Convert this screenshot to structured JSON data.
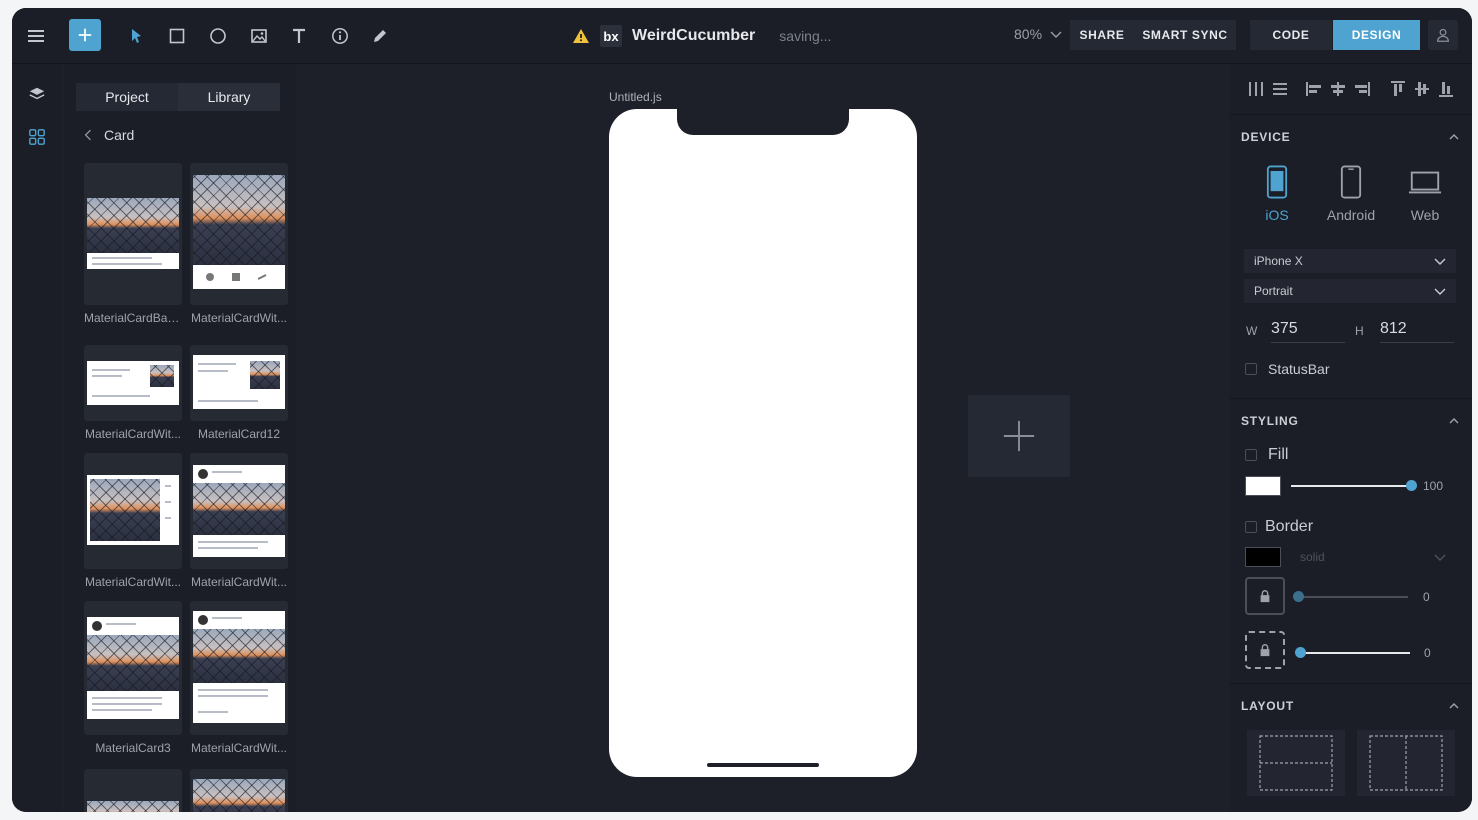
{
  "app": {
    "project_name": "WeirdCucumber",
    "logo_text": "bx",
    "status": "saving...",
    "zoom": "80%"
  },
  "toolbar": {
    "share": "SHARE",
    "smart_sync": "SMART SYNC",
    "code": "CODE",
    "design": "DESIGN"
  },
  "leftpanel": {
    "tabs": [
      {
        "label": "Project"
      },
      {
        "label": "Library"
      }
    ],
    "breadcrumb": "Card",
    "cards": [
      {
        "label": "MaterialCardBasic"
      },
      {
        "label": "MaterialCardWit..."
      },
      {
        "label": "MaterialCardWit..."
      },
      {
        "label": "MaterialCard12"
      },
      {
        "label": "MaterialCardWit..."
      },
      {
        "label": "MaterialCardWit..."
      },
      {
        "label": "MaterialCard3"
      },
      {
        "label": "MaterialCardWit..."
      }
    ]
  },
  "canvas": {
    "file_name": "Untitled.js"
  },
  "rightpanel": {
    "device": {
      "title": "DEVICE",
      "options": [
        {
          "label": "iOS"
        },
        {
          "label": "Android"
        },
        {
          "label": "Web"
        }
      ],
      "selected": "iOS",
      "model": "iPhone X",
      "orientation": "Portrait",
      "width_label": "W",
      "width": "375",
      "height_label": "H",
      "height": "812",
      "statusbar": "StatusBar"
    },
    "styling": {
      "title": "STYLING",
      "fill_label": "Fill",
      "fill_color": "#ffffff",
      "fill_opacity": "100",
      "fill_opacity_fraction": 1.0,
      "border_label": "Border",
      "border_color": "#000000",
      "border_style": "solid",
      "border_width": "0",
      "border_radius": "0"
    },
    "layout": {
      "title": "LAYOUT"
    }
  },
  "colors": {
    "accent": "#4fa3d1",
    "bg": "#1d2029",
    "panel": "#1b1e26"
  }
}
